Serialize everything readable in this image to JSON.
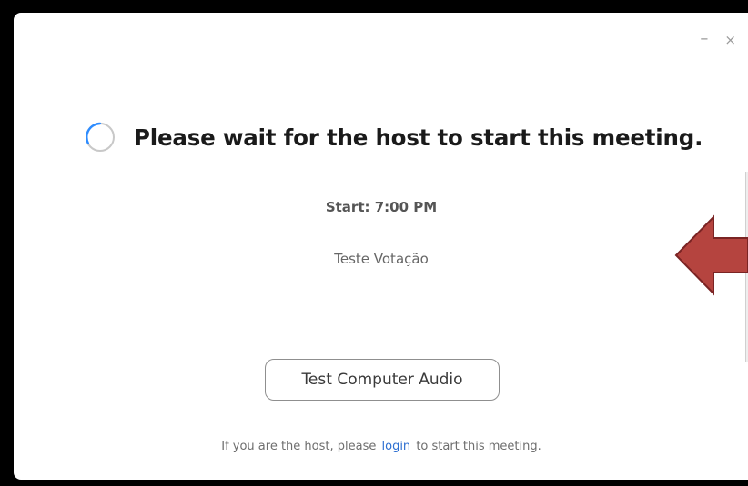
{
  "window": {
    "minimize_symbol": "–",
    "close_symbol": "×"
  },
  "main": {
    "spinner_icon": "loading-spinner-icon",
    "headline": "Please wait for the host to start this meeting.",
    "start_time": "Start: 7:00 PM",
    "meeting_name": "Teste Votação",
    "test_audio_label": "Test Computer Audio"
  },
  "footer": {
    "text_before": "If you are the host, please",
    "login_link": "login",
    "text_after": "to start this meeting."
  },
  "annotation": {
    "arrow_icon": "left-arrow-icon",
    "arrow_fill": "#b5443f",
    "arrow_stroke": "#7a2424"
  },
  "colors": {
    "link": "#2d6fd1",
    "spinner_track": "#c8c8c8",
    "spinner_accent": "#2d8cff"
  }
}
